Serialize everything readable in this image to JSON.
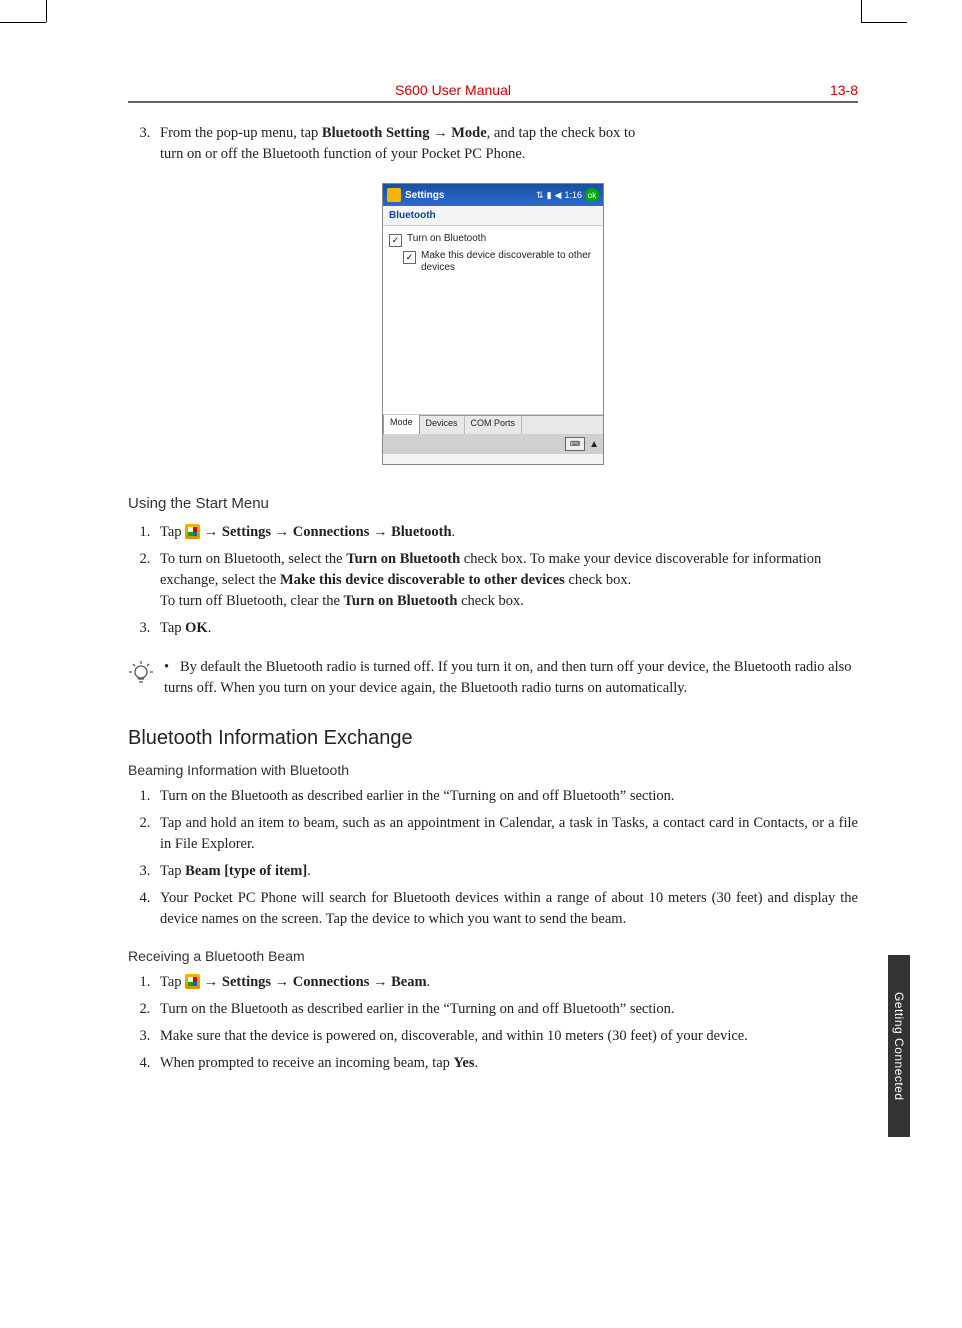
{
  "header": {
    "title": "S600 User Manual",
    "page_number": "13-8"
  },
  "side_tab": "Getting Connected",
  "intro_step": {
    "number": "3.",
    "prefix": "From the pop-up menu, tap ",
    "bold1": "Bluetooth Setting → Mode",
    "suffix": ", and tap the check box to turn on or off the Bluetooth function of your Pocket PC Phone."
  },
  "screenshot": {
    "titlebar": "Settings",
    "time": "1:16",
    "ok": "ok",
    "subtitle": "Bluetooth",
    "check1": "Turn on Bluetooth",
    "check2": "Make this device discoverable to other devices",
    "tabs": [
      "Mode",
      "Devices",
      "COM Ports"
    ]
  },
  "using_start_menu": {
    "heading": "Using the Start Menu",
    "steps": [
      {
        "prefix": "Tap ",
        "has_start_icon": true,
        "bold": " → Settings → Connections → Bluetooth",
        "suffix": "."
      },
      {
        "prefix": "To turn on Bluetooth, select the ",
        "bold1": "Turn on Bluetooth",
        "mid1": " check box. To make your device discoverable for information exchange, select the ",
        "bold2": "Make this device discoverable to other devices",
        "mid2": " check box.",
        "line2_prefix": "To turn off Bluetooth, clear the ",
        "line2_bold": "Turn on Bluetooth",
        "line2_suffix": " check box."
      },
      {
        "prefix": "Tap ",
        "bold": "OK",
        "suffix": "."
      }
    ]
  },
  "tip": {
    "bullet": "•",
    "text": "By default the Bluetooth radio is turned off. If you turn it on, and then turn off your device, the Bluetooth radio also turns off. When you turn on your device again, the Bluetooth radio turns on automatically."
  },
  "bt_exchange": {
    "heading": "Bluetooth Information Exchange",
    "beaming": {
      "heading": "Beaming Information with Bluetooth",
      "steps": [
        {
          "text": "Turn on the Bluetooth as described earlier in the “Turning on and off Bluetooth” section."
        },
        {
          "text": "Tap and hold an item to beam, such as an appointment in Calendar, a task in Tasks, a contact card in Contacts, or a file in File Explorer."
        },
        {
          "prefix": "Tap ",
          "bold": "Beam [type of item]",
          "suffix": "."
        },
        {
          "text": "Your Pocket PC Phone will search for Bluetooth devices within a range of about 10 meters (30 feet) and display the device names on the screen. Tap the device to which you want to send the beam."
        }
      ]
    },
    "receiving": {
      "heading": "Receiving a Bluetooth Beam",
      "steps": [
        {
          "prefix": "Tap ",
          "has_start_icon": true,
          "bold": " → Settings → Connections → Beam",
          "suffix": "."
        },
        {
          "text": "Turn on the Bluetooth as described earlier in the “Turning on and off Bluetooth” section."
        },
        {
          "text": "Make sure that the device is powered on, discoverable, and within 10 meters (30 feet) of your device."
        },
        {
          "prefix": "When prompted to receive an incoming beam, tap ",
          "bold": "Yes",
          "suffix": "."
        }
      ]
    }
  }
}
